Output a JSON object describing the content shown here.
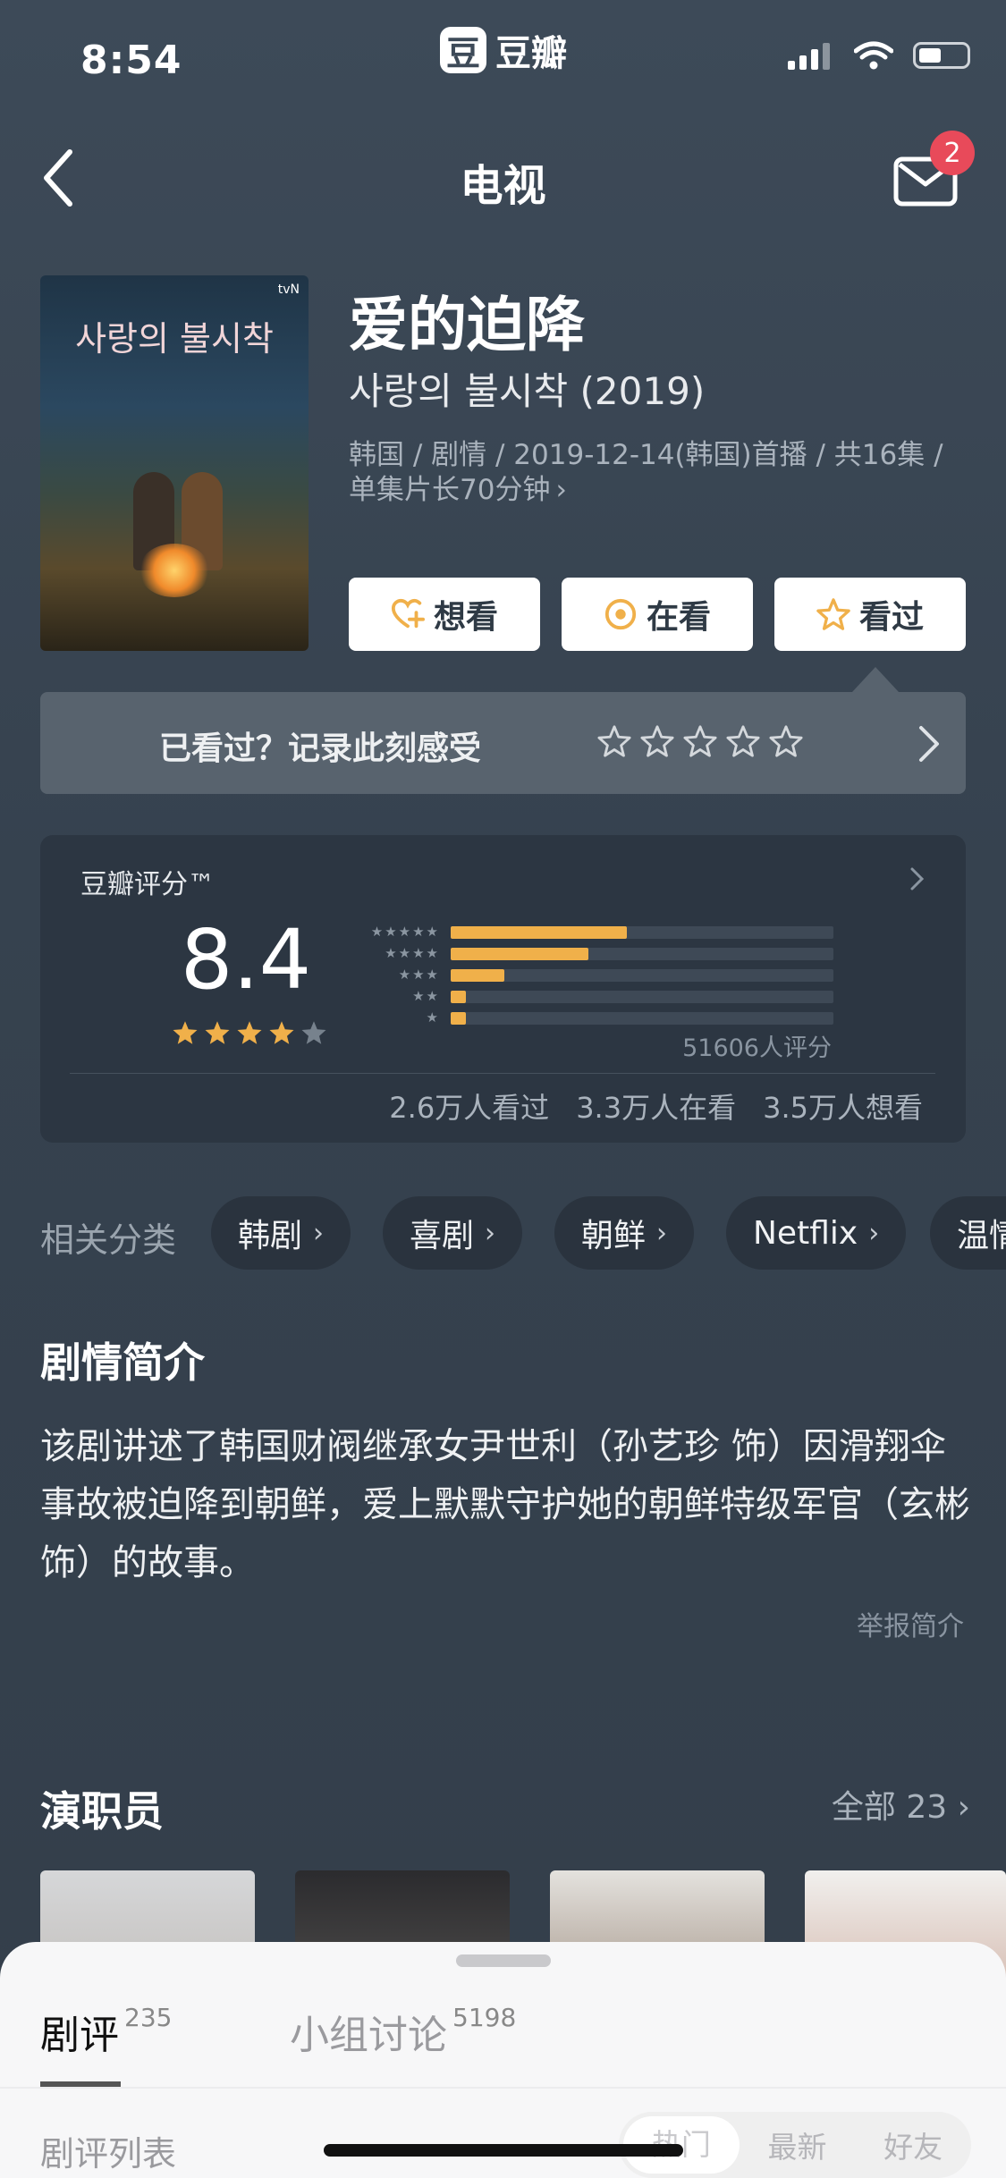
{
  "status_bar": {
    "time": "8:54",
    "app_logo": "豆",
    "app_name": "豆瓣"
  },
  "nav": {
    "title": "电视",
    "mail_badge": "2"
  },
  "show": {
    "title_cn": "爱的迫降",
    "title_original": "사랑의 불시착 (2019)",
    "meta": "韩国 / 剧情 / 2019-12-14(韩国)首播 / 共16集 / 单集片长70分钟",
    "poster_title": "사랑의 불시착",
    "poster_brand": "tvN"
  },
  "actions": [
    {
      "label": "想看",
      "icon": "heart-plus-icon"
    },
    {
      "label": "在看",
      "icon": "target-icon"
    },
    {
      "label": "看过",
      "icon": "star-outline-icon"
    }
  ],
  "record_bar": {
    "text": "已看过？记录此刻感受"
  },
  "rating": {
    "label": "豆瓣评分™",
    "score": "8.4",
    "stars": 4,
    "distribution": [
      0.46,
      0.36,
      0.14,
      0.04,
      0.04
    ],
    "count": "51606人评分",
    "stats": [
      "2.6万人看过",
      "3.3万人在看",
      "3.5万人想看"
    ]
  },
  "categories": {
    "label": "相关分类",
    "chips": [
      "韩剧",
      "喜剧",
      "朝鲜",
      "Netflix",
      "温情"
    ]
  },
  "synopsis": {
    "heading": "剧情简介",
    "text": "该剧讲述了韩国财阀继承女尹世利（孙艺珍 饰）因滑翔伞事故被迫降到朝鲜，爱上默默守护她的朝鲜特级军官（玄彬 饰）的故事。",
    "report": "举报简介"
  },
  "cast": {
    "heading": "演职员",
    "all_label": "全部 23"
  },
  "sheet": {
    "tab_reviews": "剧评",
    "tab_reviews_count": "235",
    "tab_groups": "小组讨论",
    "tab_groups_count": "5198",
    "list_label": "剧评列表",
    "filters": [
      "热门",
      "最新",
      "好友"
    ]
  }
}
